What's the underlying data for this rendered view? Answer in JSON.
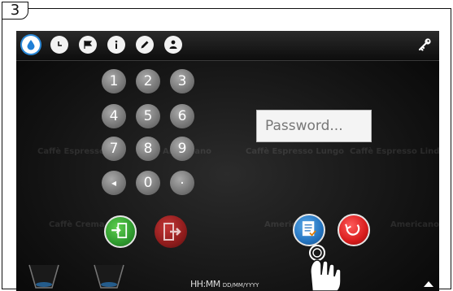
{
  "step": {
    "number": "3"
  },
  "topbar": {
    "icons": [
      "water-drop-icon",
      "clock-icon",
      "flag-icon",
      "info-icon",
      "pencil-icon",
      "user-lock-icon"
    ],
    "right_icon": "key-icon"
  },
  "background_drinks": [
    "Caffè Espresso",
    "Americano",
    "Caffè Espresso Lungo",
    "Caffè Espresso Lindo",
    "Caffè Crema",
    "Americano",
    "Americano"
  ],
  "keypad": {
    "rows": [
      [
        "1",
        "2",
        "3"
      ],
      [
        "4",
        "5",
        "6"
      ],
      [
        "7",
        "8",
        "9"
      ],
      [
        "◂",
        "0",
        "."
      ]
    ]
  },
  "password": {
    "placeholder": "Password..."
  },
  "actions": {
    "login": "login-door-icon",
    "logout": "logout-door-icon",
    "checklist": "checklist-icon",
    "cancel": "cancel-icon"
  },
  "bottombar": {
    "time_format": "HH:MM",
    "date_format": "DD/MM/YYYY"
  },
  "colors": {
    "accent": "#2b89d8",
    "login_green": "#2f9a2f",
    "logout_red": "#b02020",
    "cancel_red": "#d81c1c"
  }
}
